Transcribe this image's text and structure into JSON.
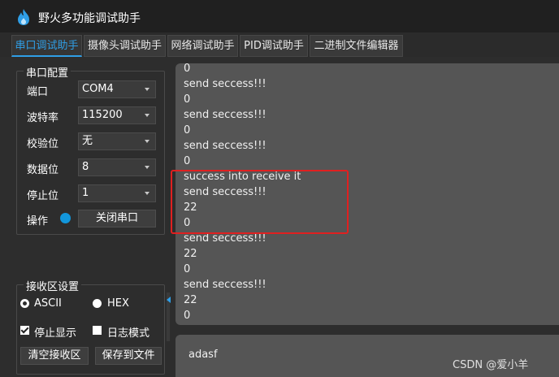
{
  "window": {
    "title": "野火多功能调试助手",
    "icon": "flame-icon"
  },
  "tabs": [
    {
      "label": "串口调试助手",
      "active": true
    },
    {
      "label": "摄像头调试助手",
      "active": false
    },
    {
      "label": "网络调试助手",
      "active": false
    },
    {
      "label": "PID调试助手",
      "active": false
    },
    {
      "label": "二进制文件编辑器",
      "active": false
    }
  ],
  "serial_config": {
    "title": "串口配置",
    "port": {
      "label": "端口",
      "value": "COM4"
    },
    "baud": {
      "label": "波特率",
      "value": "115200"
    },
    "parity": {
      "label": "校验位",
      "value": "无"
    },
    "databits": {
      "label": "数据位",
      "value": "8"
    },
    "stopbits": {
      "label": "停止位",
      "value": "1"
    },
    "operation": {
      "label": "操作",
      "button": "关闭串口",
      "status_color": "#1296db"
    }
  },
  "receive_settings": {
    "title": "接收区设置",
    "ascii_label": "ASCII",
    "hex_label": "HEX",
    "ascii_checked": true,
    "stop_display_label": "停止显示",
    "stop_display_checked": true,
    "log_mode_label": "日志模式",
    "log_mode_checked": false,
    "clear_button": "清空接收区",
    "save_button": "保存到文件"
  },
  "receive_area": {
    "lines": [
      "0",
      "send seccess!!!",
      "0",
      "send seccess!!!",
      "0",
      "send seccess!!!",
      "0",
      "success into receive it",
      "send seccess!!!",
      "22",
      "0",
      "send seccess!!!",
      "22",
      "0",
      "send seccess!!!",
      "22",
      "0"
    ],
    "highlight_color": "#e02020"
  },
  "send_area": {
    "text": "adasf"
  },
  "watermark": "CSDN @爱小羊"
}
